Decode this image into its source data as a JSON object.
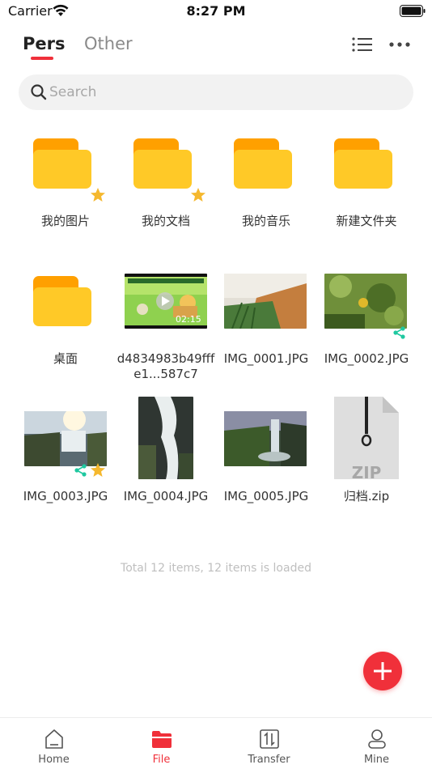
{
  "status_bar": {
    "carrier": "Carrier",
    "time": "8:27 PM"
  },
  "tabs": [
    {
      "label": "Pers",
      "active": true
    },
    {
      "label": "Other",
      "active": false
    }
  ],
  "header_icons": [
    "list-view-icon",
    "more-icon"
  ],
  "search": {
    "placeholder": "Search",
    "value": ""
  },
  "items": [
    {
      "name": "我的图片",
      "kind": "folder",
      "starred": true,
      "shared": false
    },
    {
      "name": "我的文档",
      "kind": "folder",
      "starred": true,
      "shared": false
    },
    {
      "name": "我的音乐",
      "kind": "folder",
      "starred": false,
      "shared": false
    },
    {
      "name": "新建文件夹",
      "kind": "folder",
      "starred": false,
      "shared": false
    },
    {
      "name": "桌面",
      "kind": "folder",
      "starred": false,
      "shared": false
    },
    {
      "name": "d4834983b49fffe1...587c7",
      "kind": "video",
      "duration": "02:15",
      "starred": false,
      "shared": false
    },
    {
      "name": "IMG_0001.JPG",
      "kind": "image",
      "starred": false,
      "shared": false
    },
    {
      "name": "IMG_0002.JPG",
      "kind": "image",
      "starred": false,
      "shared": true
    },
    {
      "name": "IMG_0003.JPG",
      "kind": "image",
      "starred": true,
      "shared": true
    },
    {
      "name": "IMG_0004.JPG",
      "kind": "image",
      "starred": false,
      "shared": false
    },
    {
      "name": "IMG_0005.JPG",
      "kind": "image",
      "starred": false,
      "shared": false
    },
    {
      "name": "归档.zip",
      "kind": "archive",
      "icon_text": "ZIP",
      "starred": false,
      "shared": false
    }
  ],
  "footer": "Total 12 items, 12 items is loaded",
  "fab_icon": "plus-icon",
  "tab_bar": [
    {
      "label": "Home",
      "icon": "home-icon",
      "active": false
    },
    {
      "label": "File",
      "icon": "folder-icon",
      "active": true
    },
    {
      "label": "Transfer",
      "icon": "transfer-icon",
      "active": false
    },
    {
      "label": "Mine",
      "icon": "person-icon",
      "active": false
    }
  ],
  "colors": {
    "accent": "#f0303a",
    "folder": "#ffc927",
    "folder_back": "#ffa000",
    "star": "#f5b82e",
    "share": "#1fc8a0"
  }
}
